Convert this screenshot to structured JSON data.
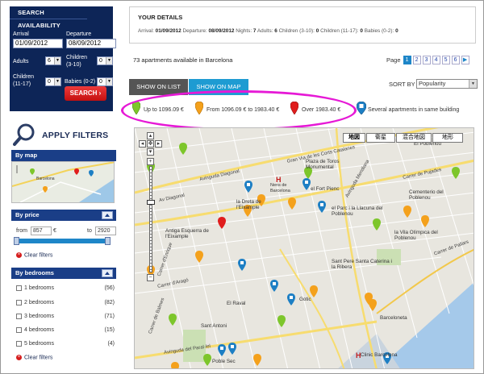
{
  "search": {
    "title": "SEARCH AVAILABILITY",
    "arrival_label": "Arrival",
    "departure_label": "Departure",
    "arrival_value": "01/09/2012",
    "departure_value": "08/09/2012",
    "adults_label": "Adults",
    "adults_value": "6",
    "children_3_10_label": "Children (3-10)",
    "children_3_10_value": "0",
    "children_11_17_label": "Children (11-17)",
    "children_11_17_value": "0",
    "babies_label": "Babies (0-2)",
    "babies_value": "0",
    "button": "SEARCH"
  },
  "details": {
    "title": "YOUR DETAILS",
    "arrival_label": "Arrival:",
    "arrival": "01/09/2012",
    "departure_label": "Departure:",
    "departure": "08/09/2012",
    "nights_label": "Nights:",
    "nights": "7",
    "adults_label": "Adults:",
    "adults": "6",
    "children_3_10_label": "Children (3-10):",
    "children_3_10": "0",
    "children_11_17_label": "Children (11-17):",
    "children_11_17": "0",
    "babies_label": "Babies (0-2):",
    "babies": "0"
  },
  "results": {
    "count_text": "73 apartments available in Barcelona",
    "page_label": "Page",
    "pages": [
      "1",
      "2",
      "3",
      "4",
      "5",
      "6"
    ],
    "current_page": "1",
    "next": "▶"
  },
  "tabs": {
    "list": "SHOW ON LIST",
    "map": "SHOW ON MAP"
  },
  "sort": {
    "label": "SORT BY",
    "value": "Popularity"
  },
  "legend": {
    "green": "Up to 1096.09 €",
    "orange": "From 1096.09 € to 1983.40 €",
    "red": "Over 1983.40 €",
    "blue": "Several apartments in same building",
    "colors": {
      "green": "#7dc62b",
      "orange": "#f4a11c",
      "red": "#e01d1d",
      "blue": "#1d7fc4"
    }
  },
  "filters": {
    "title": "APPLY FILTERS",
    "by_map": "By map",
    "by_price": "By price",
    "price_from_label": "from",
    "price_from": "857",
    "price_to_label": "to",
    "price_to": "2920",
    "currency": "€",
    "clear": "Clear filters",
    "by_bedrooms": "By bedrooms",
    "bedrooms": [
      {
        "label": "1 bedrooms",
        "count": "(56)"
      },
      {
        "label": "2 bedrooms",
        "count": "(82)"
      },
      {
        "label": "3 bedrooms",
        "count": "(71)"
      },
      {
        "label": "4 bedrooms",
        "count": "(15)"
      },
      {
        "label": "5 bedrooms",
        "count": "(4)"
      }
    ],
    "minimap_label": "Barcelona"
  },
  "map": {
    "type_buttons": [
      "地図",
      "衛星",
      "混合地図",
      "地形"
    ],
    "labels": [
      {
        "text": "El Poblenou"
      },
      {
        "text": "Plaza de Toros Monumental"
      },
      {
        "text": "Nens de Barcelona"
      },
      {
        "text": "el Fort Pienc"
      },
      {
        "text": "Cementerio del Poblenou"
      },
      {
        "text": "la Dreta de l'Eixample"
      },
      {
        "text": "el Parc i la Llacuna del Poblenou"
      },
      {
        "text": "Antiga Esquerra de l'Eixample"
      },
      {
        "text": "la Vila Olímpica del Poblenou"
      },
      {
        "text": "Sant Pere Santa Caterina i la Ribera"
      },
      {
        "text": "El Raval"
      },
      {
        "text": "Gotic"
      },
      {
        "text": "Sant Antoni"
      },
      {
        "text": "Barceloneta"
      },
      {
        "text": "Poble Sec"
      },
      {
        "text": "Clinic Barcelona"
      }
    ],
    "roads": [
      {
        "text": "Avinguda Diagonal"
      },
      {
        "text": "Av Diagonal"
      },
      {
        "text": "Gran Via de les Corts Catalanes"
      },
      {
        "text": "Carrer de Pujades"
      },
      {
        "text": "Avinguda Meridiana"
      },
      {
        "text": "Carrer d'Aragó"
      },
      {
        "text": "Avinguda del Paral·lel"
      },
      {
        "text": "Carrer de Balmes"
      },
      {
        "text": "Carrer d'Enrique"
      },
      {
        "text": "Carrer de Pallars"
      }
    ]
  }
}
